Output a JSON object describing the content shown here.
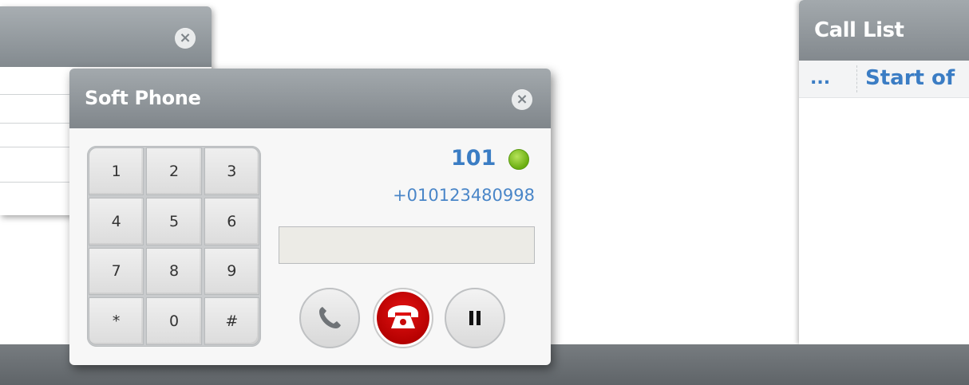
{
  "soft_phone": {
    "title": "Soft Phone",
    "extension": "101",
    "status_color": "#7cc41f",
    "number": "+010123480998",
    "dial_input_value": "",
    "keypad": [
      {
        "label": "1"
      },
      {
        "label": "2"
      },
      {
        "label": "3"
      },
      {
        "label": "4"
      },
      {
        "label": "5"
      },
      {
        "label": "6"
      },
      {
        "label": "7"
      },
      {
        "label": "8"
      },
      {
        "label": "9"
      },
      {
        "label": "*"
      },
      {
        "label": "0"
      },
      {
        "label": "#"
      }
    ],
    "buttons": {
      "call_icon": "phone-icon",
      "hangup_icon": "hang-up-icon",
      "hold_icon": "pause-icon"
    }
  },
  "call_list": {
    "title": "Call List",
    "columns": [
      "...",
      "Start of"
    ]
  },
  "colors": {
    "accent": "#3b7dc4",
    "titlebar": "#8f959a",
    "hangup": "#cc0000"
  }
}
